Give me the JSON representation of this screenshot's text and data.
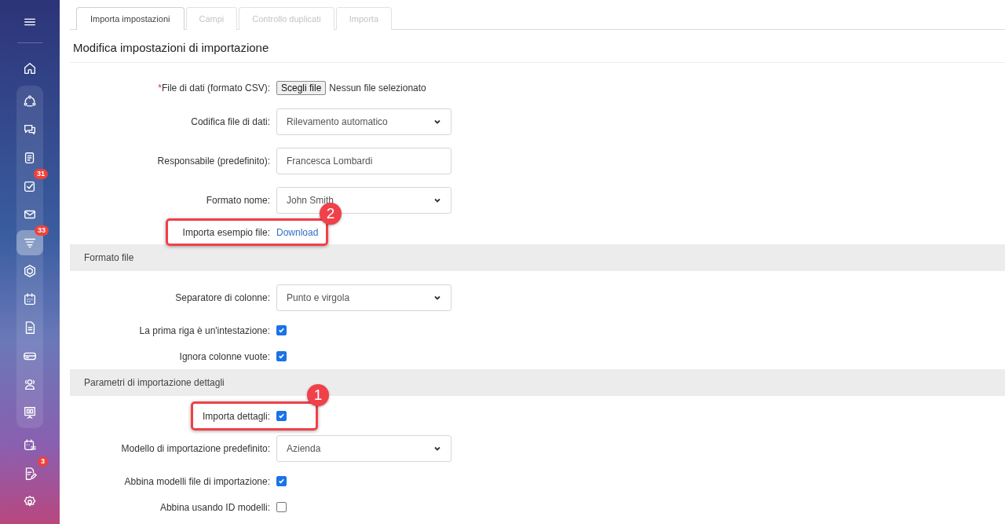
{
  "sidebar": {
    "top": [
      {
        "selected": false
      }
    ],
    "group": [
      {
        "selected": false
      },
      {
        "selected": false
      },
      {
        "selected": false
      },
      {
        "selected": false,
        "badge": "31"
      },
      {
        "selected": false
      },
      {
        "selected": true,
        "badge": "33"
      },
      {
        "selected": false
      },
      {
        "selected": false
      },
      {
        "selected": false
      },
      {
        "selected": false
      },
      {
        "selected": false
      },
      {
        "selected": false
      }
    ],
    "bottom": [
      {
        "selected": false
      },
      {
        "selected": false,
        "badge": "3"
      }
    ],
    "footer": [
      {
        "selected": false
      }
    ]
  },
  "tabs": [
    {
      "label": "Importa impostazioni",
      "selected": true
    },
    {
      "label": "Campi",
      "selected": false
    },
    {
      "label": "Controllo duplicati",
      "selected": false
    },
    {
      "label": "Importa",
      "selected": false
    }
  ],
  "title": "Modifica impostazioni di importazione",
  "rows": [
    {
      "kind": "file",
      "label": "File di dati (formato CSV):",
      "marker": "*",
      "button": "Scegli file",
      "value": "Nessun file selezionato"
    },
    {
      "kind": "select",
      "label": "Codifica file di dati:",
      "value": "Rilevamento automatico"
    },
    {
      "kind": "text",
      "label": "Responsabile (predefinito):",
      "value": "Francesca Lombardi"
    },
    {
      "kind": "select",
      "label": "Formato nome:",
      "value": "John Smith"
    },
    {
      "kind": "link",
      "label": "Importa esempio file:",
      "value": "Download",
      "callout": "2"
    },
    {
      "kind": "section",
      "label": "Formato file"
    },
    {
      "kind": "select",
      "label": "Separatore di colonne:",
      "value": "Punto e virgola"
    },
    {
      "kind": "checkbox",
      "label": "La prima riga è un'intestazione:",
      "checked": true
    },
    {
      "kind": "checkbox",
      "label": "Ignora colonne vuote:",
      "checked": true
    },
    {
      "kind": "section",
      "label": "Parametri di importazione dettagli"
    },
    {
      "kind": "checkbox",
      "label": "Importa dettagli:",
      "checked": true,
      "callout": "1"
    },
    {
      "kind": "select",
      "label": "Modello di importazione predefinito:",
      "value": "Azienda"
    },
    {
      "kind": "checkbox",
      "label": "Abbina modelli file di importazione:",
      "checked": true
    },
    {
      "kind": "checkbox",
      "label": "Abbina usando ID modelli:",
      "checked": false
    }
  ]
}
